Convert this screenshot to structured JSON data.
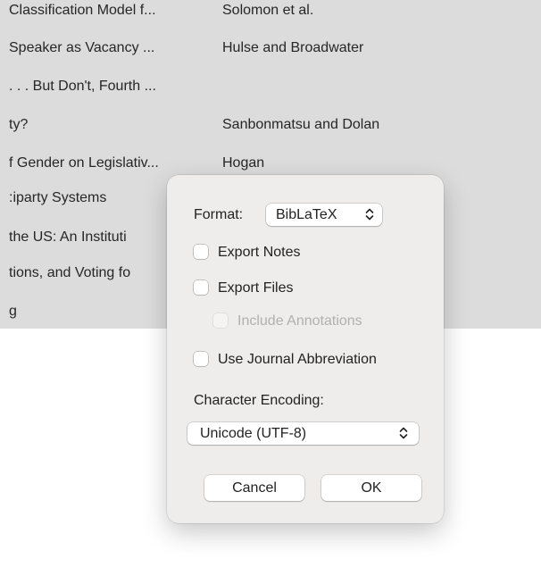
{
  "list": {
    "rows": [
      {
        "title": "Classification Model f...",
        "author": "Solomon et al."
      },
      {
        "title": "Speaker as Vacancy ...",
        "author": "Hulse and Broadwater"
      },
      {
        "title": ". . . But Don't, Fourth ...",
        "author": ""
      },
      {
        "title": "ty?",
        "author": "Sanbonmatsu and Dolan"
      },
      {
        "title": "f Gender on Legislativ...",
        "author": "Hogan"
      },
      {
        "title": ":iparty Systems",
        "author": ""
      },
      {
        "title": " the US: An Instituti",
        "author": ""
      },
      {
        "title": "tions, and Voting fo",
        "author": ""
      },
      {
        "title": "g",
        "author": ""
      }
    ]
  },
  "dialog": {
    "format_label": "Format:",
    "format_value": "BibLaTeX",
    "export_notes": {
      "label": "Export Notes",
      "checked": false
    },
    "export_files": {
      "label": "Export Files",
      "checked": false
    },
    "include_annotations": {
      "label": "Include Annotations",
      "checked": false,
      "disabled": true
    },
    "use_journal_abbreviation": {
      "label": "Use Journal Abbreviation",
      "checked": false
    },
    "encoding_label": "Character Encoding:",
    "encoding_value": "Unicode (UTF-8)",
    "cancel_label": "Cancel",
    "ok_label": "OK"
  },
  "icons": {
    "select_chevron": "up-down-chevron-icon"
  }
}
